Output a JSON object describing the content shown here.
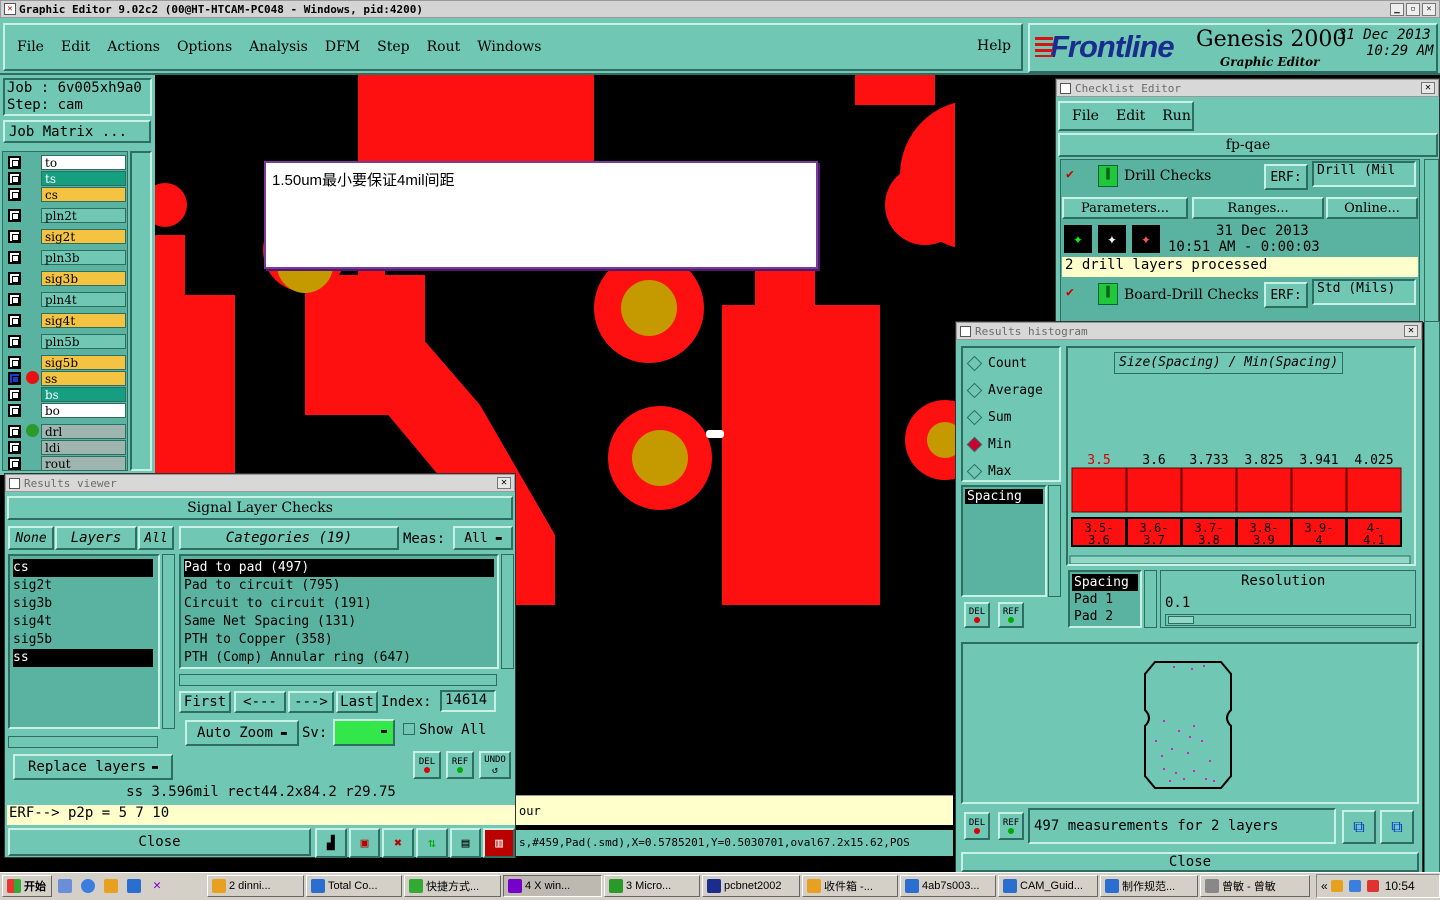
{
  "window_title": "Graphic Editor 9.02c2 (00@HT-HTCAM-PC048 - Windows, pid:4200)",
  "menu": [
    "File",
    "Edit",
    "Actions",
    "Options",
    "Analysis",
    "DFM",
    "Step",
    "Rout",
    "Windows"
  ],
  "help": "Help",
  "brand": {
    "logo": "Frontline",
    "product": "Genesis 2000",
    "subtitle": "Graphic Editor",
    "date": "31 Dec 2013",
    "time": "10:29 AM"
  },
  "job": {
    "job": "Job : 6v005xh9a0",
    "step": "Step: cam",
    "matrix": "Job Matrix ..."
  },
  "layers": [
    {
      "name": "to",
      "color": "#ffffff"
    },
    {
      "name": "ts",
      "color": "#159e80"
    },
    {
      "name": "cs",
      "color": "#f5c342"
    },
    {
      "name": "pln2t",
      "color": "#6fc7b4"
    },
    {
      "name": "sig2t",
      "color": "#f5c342"
    },
    {
      "name": "pln3b",
      "color": "#6fc7b4"
    },
    {
      "name": "sig3b",
      "color": "#f5c342"
    },
    {
      "name": "pln4t",
      "color": "#6fc7b4"
    },
    {
      "name": "sig4t",
      "color": "#f5c342"
    },
    {
      "name": "pln5b",
      "color": "#6fc7b4"
    },
    {
      "name": "sig5b",
      "color": "#f5c342"
    },
    {
      "name": "ss",
      "color": "#f5c342"
    },
    {
      "name": "bs",
      "color": "#159e80"
    },
    {
      "name": "bo",
      "color": "#ffffff"
    },
    {
      "name": "drl",
      "color": "#9fb5b0"
    },
    {
      "name": "ldi",
      "color": "#9fb5b0"
    },
    {
      "name": "rout",
      "color": "#9fb5b0"
    }
  ],
  "note_text": "1.50um最小要保证4mil间距",
  "results_viewer": {
    "title": "Results viewer",
    "header": "Signal Layer Checks",
    "none": "None",
    "layers_label": "Layers",
    "all": "All",
    "categories_label": "Categories (19)",
    "meas_label": "Meas:",
    "meas_value": "All",
    "layer_list": [
      "cs",
      "sig2t",
      "sig3b",
      "sig4t",
      "sig5b",
      "ss"
    ],
    "categories": [
      "Pad to pad (497)",
      "Pad to circuit (795)",
      "Circuit to circuit (191)",
      "Same Net Spacing (131)",
      "PTH to Copper (358)",
      "PTH (Comp) Annular ring (647)"
    ],
    "first": "First",
    "prev": "<---",
    "next": "--->",
    "last": "Last",
    "index_label": "Index:",
    "index_value": "14614",
    "auto_zoom": "Auto Zoom",
    "sv_label": "Sv:",
    "show_all": "Show All",
    "replace_layers": "Replace layers",
    "info_line": "ss 3.596mil   rect44.2x84.2   r29.75",
    "erf_line": "ERF--> p2p = 5 7 10",
    "close": "Close",
    "del": "DEL",
    "ref": "REF",
    "undo": "UNDO"
  },
  "status_text": "our",
  "coord_text": "s,#459,Pad(.smd),X=0.5785201,Y=0.5030701,oval67.2x15.62,POS",
  "checklist": {
    "title": "Checklist Editor",
    "menu": [
      "File",
      "Edit",
      "Run"
    ],
    "name": "fp-qae",
    "action1": "Drill Checks",
    "erf_label": "ERF:",
    "erf1": "Drill (Mil",
    "parameters": "Parameters...",
    "ranges": "Ranges...",
    "online": "Online...",
    "run_date": "31 Dec 2013",
    "run_time": "10:51 AM - 0:00:03",
    "status": "2 drill layers processed",
    "action2": "Board-Drill Checks",
    "erf2": "Std (Mils)"
  },
  "histogram": {
    "title": "Results histogram",
    "modes": [
      "Count",
      "Average",
      "Sum",
      "Min",
      "Max"
    ],
    "selected_mode": "Min",
    "chart_title": "Size(Spacing) / Min(Spacing)",
    "list": [
      "Spacing"
    ],
    "bars": [
      {
        "label": "3.5",
        "range": "3.5-3.6"
      },
      {
        "label": "3.6",
        "range": "3.6-3.7"
      },
      {
        "label": "3.733",
        "range": "3.7-3.8"
      },
      {
        "label": "3.825",
        "range": "3.8-3.9"
      },
      {
        "label": "3.941",
        "range": "3.9-4"
      },
      {
        "label": "4.025",
        "range": "4-4.1"
      }
    ],
    "sel_list": [
      "Spacing",
      "Pad 1",
      "Pad 2"
    ],
    "resolution_label": "Resolution",
    "resolution_value": "0.1",
    "measurements": "497 measurements for 2 layers",
    "close": "Close",
    "del": "DEL",
    "ref": "REF"
  },
  "taskbar": {
    "start": "开始",
    "items": [
      "2 dinni...",
      "Total Co...",
      "快捷方式...",
      "4 X win...",
      "3 Micro...",
      "pcbnet2002",
      "收件箱 -...",
      "4ab7s003...",
      "CAM_Guid...",
      "制作规范...",
      "曾敏 - 曾敏"
    ],
    "clock": "10:54"
  }
}
